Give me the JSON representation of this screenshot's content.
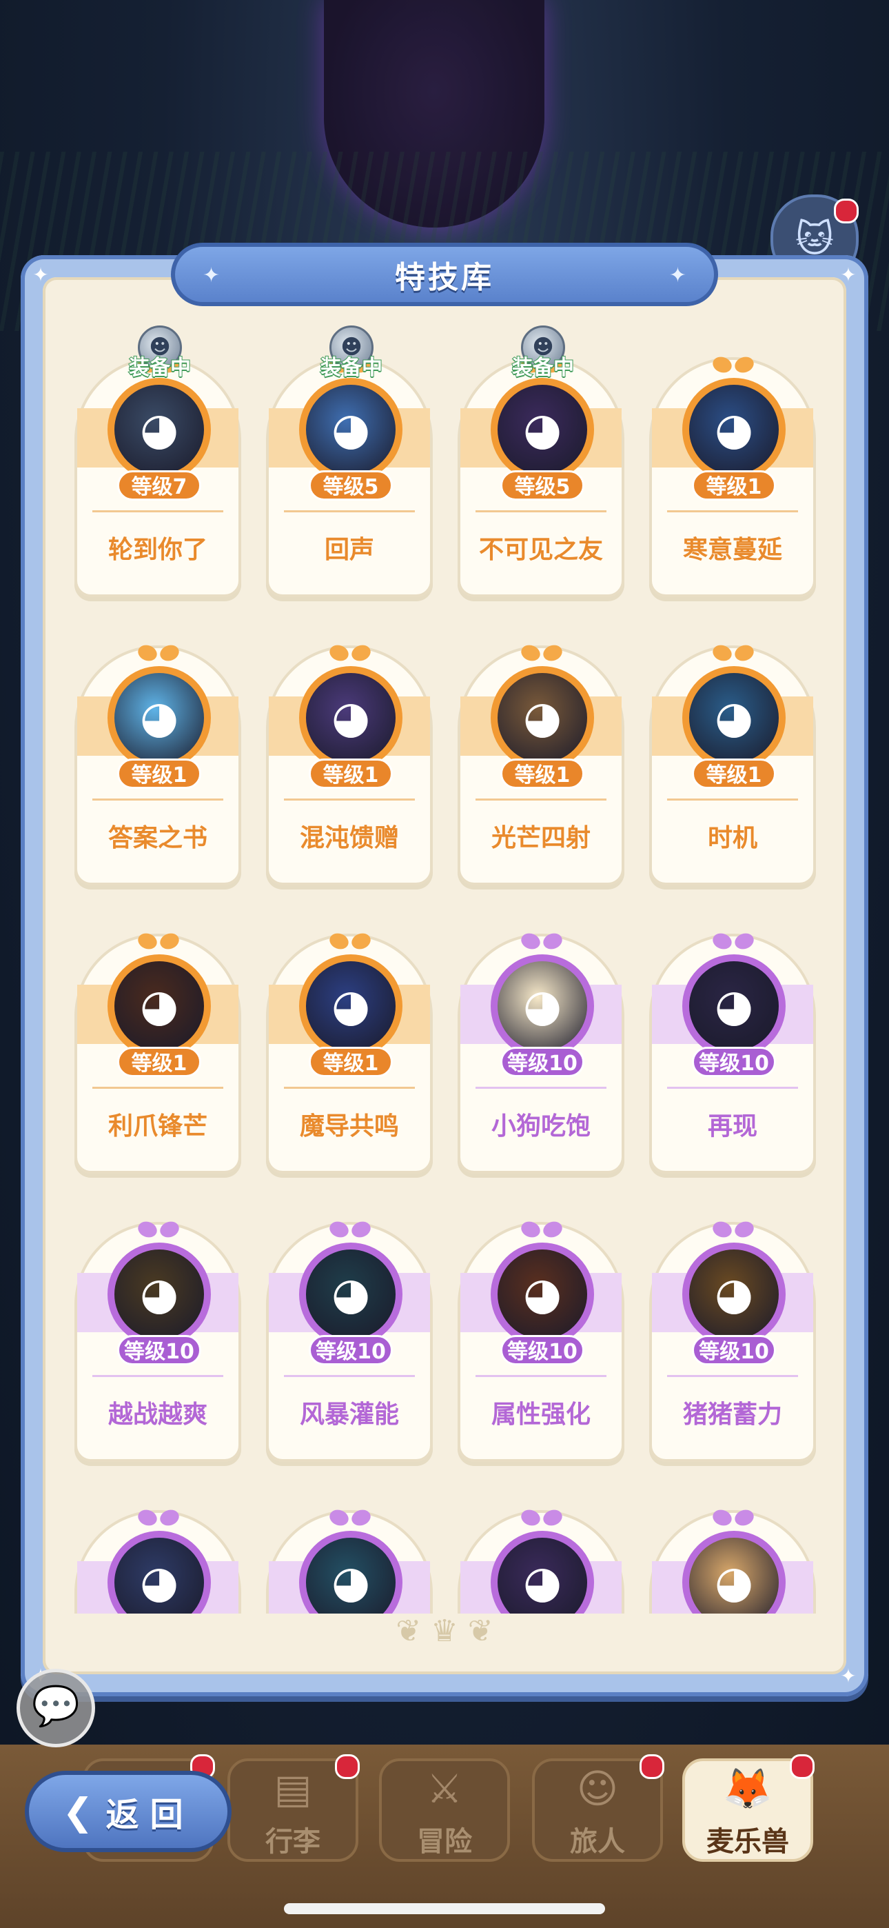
{
  "panel": {
    "title": "特技库"
  },
  "equipped_label": "装备中",
  "cards": [
    {
      "name": "轮到你了",
      "level": "等级7",
      "tier": "orange",
      "equipped": true,
      "icon": "hero-portrait-icon"
    },
    {
      "name": "回声",
      "level": "等级5",
      "tier": "orange",
      "equipped": true,
      "icon": "hero-portrait-icon"
    },
    {
      "name": "不可见之友",
      "level": "等级5",
      "tier": "orange",
      "equipped": true,
      "icon": "hero-portrait-icon"
    },
    {
      "name": "寒意蔓延",
      "level": "等级1",
      "tier": "orange",
      "equipped": false,
      "icon": "hero-portrait-icon"
    },
    {
      "name": "答案之书",
      "level": "等级1",
      "tier": "orange",
      "equipped": false,
      "icon": "hero-portrait-icon"
    },
    {
      "name": "混沌馈赠",
      "level": "等级1",
      "tier": "orange",
      "equipped": false,
      "icon": "hero-portrait-icon"
    },
    {
      "name": "光芒四射",
      "level": "等级1",
      "tier": "orange",
      "equipped": false,
      "icon": "hero-portrait-icon"
    },
    {
      "name": "时机",
      "level": "等级1",
      "tier": "orange",
      "equipped": false,
      "icon": "hero-portrait-icon"
    },
    {
      "name": "利爪锋芒",
      "level": "等级1",
      "tier": "orange",
      "equipped": false,
      "icon": "hero-portrait-icon"
    },
    {
      "name": "魔导共鸣",
      "level": "等级1",
      "tier": "orange",
      "equipped": false,
      "icon": "hero-portrait-icon"
    },
    {
      "name": "小狗吃饱",
      "level": "等级10",
      "tier": "purple",
      "equipped": false,
      "icon": "hero-portrait-icon"
    },
    {
      "name": "再现",
      "level": "等级10",
      "tier": "purple",
      "equipped": false,
      "icon": "hero-portrait-icon"
    },
    {
      "name": "越战越爽",
      "level": "等级10",
      "tier": "purple",
      "equipped": false,
      "icon": "hero-portrait-icon"
    },
    {
      "name": "风暴灌能",
      "level": "等级10",
      "tier": "purple",
      "equipped": false,
      "icon": "hero-portrait-icon"
    },
    {
      "name": "属性强化",
      "level": "等级10",
      "tier": "purple",
      "equipped": false,
      "icon": "hero-portrait-icon"
    },
    {
      "name": "猪猪蓄力",
      "level": "等级10",
      "tier": "purple",
      "equipped": false,
      "icon": "hero-portrait-icon"
    },
    {
      "name": "",
      "level": "",
      "tier": "purple",
      "equipped": false,
      "icon": "hero-portrait-icon"
    },
    {
      "name": "",
      "level": "",
      "tier": "purple",
      "equipped": false,
      "icon": "hero-portrait-icon"
    },
    {
      "name": "",
      "level": "",
      "tier": "purple",
      "equipped": false,
      "icon": "hero-portrait-icon"
    },
    {
      "name": "",
      "level": "",
      "tier": "purple",
      "equipped": false,
      "icon": "hero-portrait-icon"
    }
  ],
  "nav": [
    {
      "label": "",
      "icon": "home-icon",
      "badge": true,
      "active": false
    },
    {
      "label": "行李",
      "icon": "backpack-icon",
      "badge": true,
      "active": false
    },
    {
      "label": "冒险",
      "icon": "swords-icon",
      "badge": false,
      "active": false
    },
    {
      "label": "旅人",
      "icon": "traveler-icon",
      "badge": true,
      "active": false
    },
    {
      "label": "麦乐兽",
      "icon": "fox-icon",
      "badge": true,
      "active": true
    }
  ],
  "back_button": {
    "label": "返回"
  },
  "colors": {
    "orange": "#e98a2c",
    "purple": "#b367d6",
    "panel_blue": "#5b80c4",
    "cream": "#f6efdf"
  }
}
